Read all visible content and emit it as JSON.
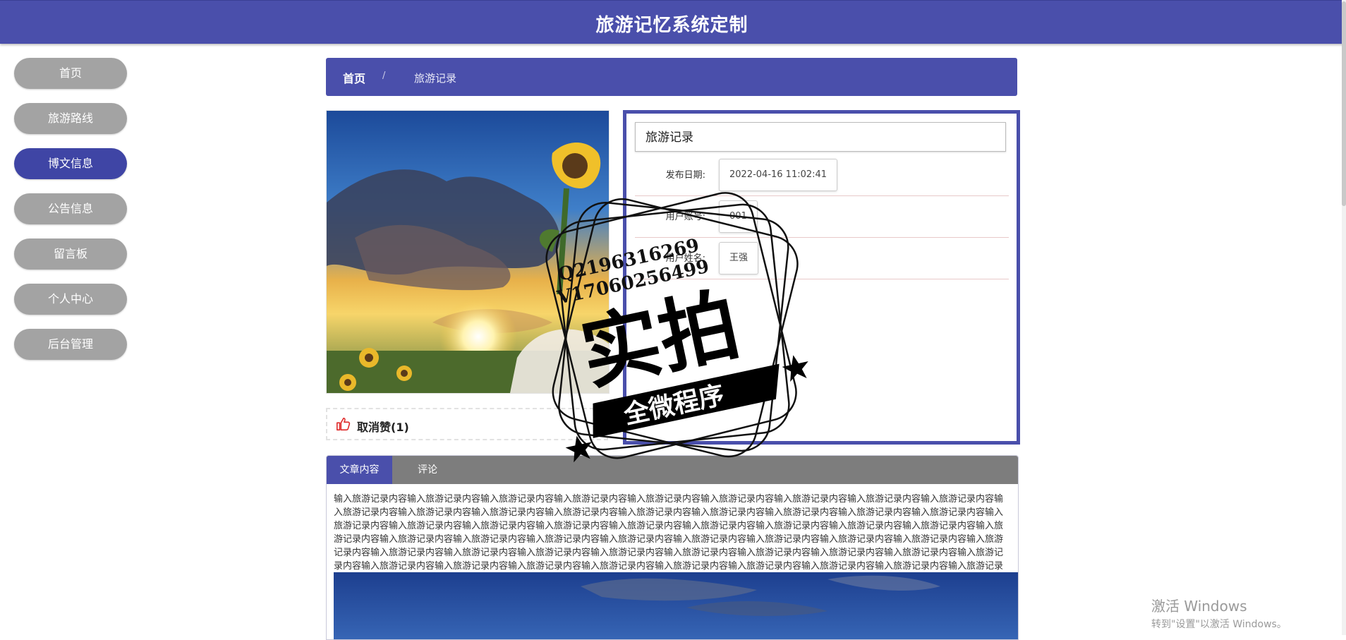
{
  "header": {
    "title": "旅游记忆系统定制"
  },
  "sidebar": {
    "items": [
      {
        "label": "首页"
      },
      {
        "label": "旅游路线"
      },
      {
        "label": "博文信息"
      },
      {
        "label": "公告信息"
      },
      {
        "label": "留言板"
      },
      {
        "label": "个人中心"
      },
      {
        "label": "后台管理"
      }
    ],
    "active_index": 2
  },
  "breadcrumb": {
    "home": "首页",
    "separator": "/",
    "current": "旅游记录"
  },
  "record": {
    "title": "旅游记录",
    "fields": [
      {
        "label": "发布日期:",
        "value": "2022-04-16 11:02:41"
      },
      {
        "label": "用户账号:",
        "value": "001"
      },
      {
        "label": "用户姓名:",
        "value": "王强"
      }
    ]
  },
  "like": {
    "label": "取消赞(1)"
  },
  "tabs": [
    {
      "label": "文章内容"
    },
    {
      "label": "评论"
    }
  ],
  "article": {
    "content": "输入旅游记录内容输入旅游记录内容输入旅游记录内容输入旅游记录内容输入旅游记录内容输入旅游记录内容输入旅游记录内容输入旅游记录内容输入旅游记录内容输入旅游记录内容输入旅游记录内容输入旅游记录内容输入旅游记录内容输入旅游记录内容输入旅游记录内容输入旅游记录内容输入旅游记录内容输入旅游记录内容输入旅游记录内容输入旅游记录内容输入旅游记录内容输入旅游记录内容输入旅游记录内容输入旅游记录内容输入旅游记录内容输入旅游记录内容输入旅游记录内容输入旅游记录内容输入旅游记录内容输入旅游记录内容输入旅游记录内容输入旅游记录内容输入旅游记录内容输入旅游记录内容输入旅游记录内容输入旅游记录内容输入旅游记录内容输入旅游记录内容输入旅游记录内容输入旅游记录内容输入旅游记录内容输入旅游记录内容输入旅游记录内容输入旅游记录内容输入旅游记录内容输入旅游记录内容输入旅游记录内容输入旅游记录内容输入旅游记录内容输入旅游记录内容输入旅游记录内容输入旅游记录内容输入旅游记录内容输入旅游记录内容输入旅游记录内容输入旅游记录内容输入旅游记录内容输入旅游记录内容输入旅游记录内容输入旅游记录内容输入旅游记录内容"
  },
  "watermark": {
    "qq": "Q2196316269",
    "vx": "V17060256499",
    "main": "实拍",
    "banner": "全微程序"
  },
  "windows_activation": {
    "line1": "激活 Windows",
    "line2": "转到\"设置\"以激活 Windows。"
  },
  "colors": {
    "primary": "#4a4fab",
    "nav_inactive": "#a3a3a3",
    "tab_bar": "#7d7d7d"
  },
  "icons": {
    "like": "thumbs-up-icon"
  }
}
